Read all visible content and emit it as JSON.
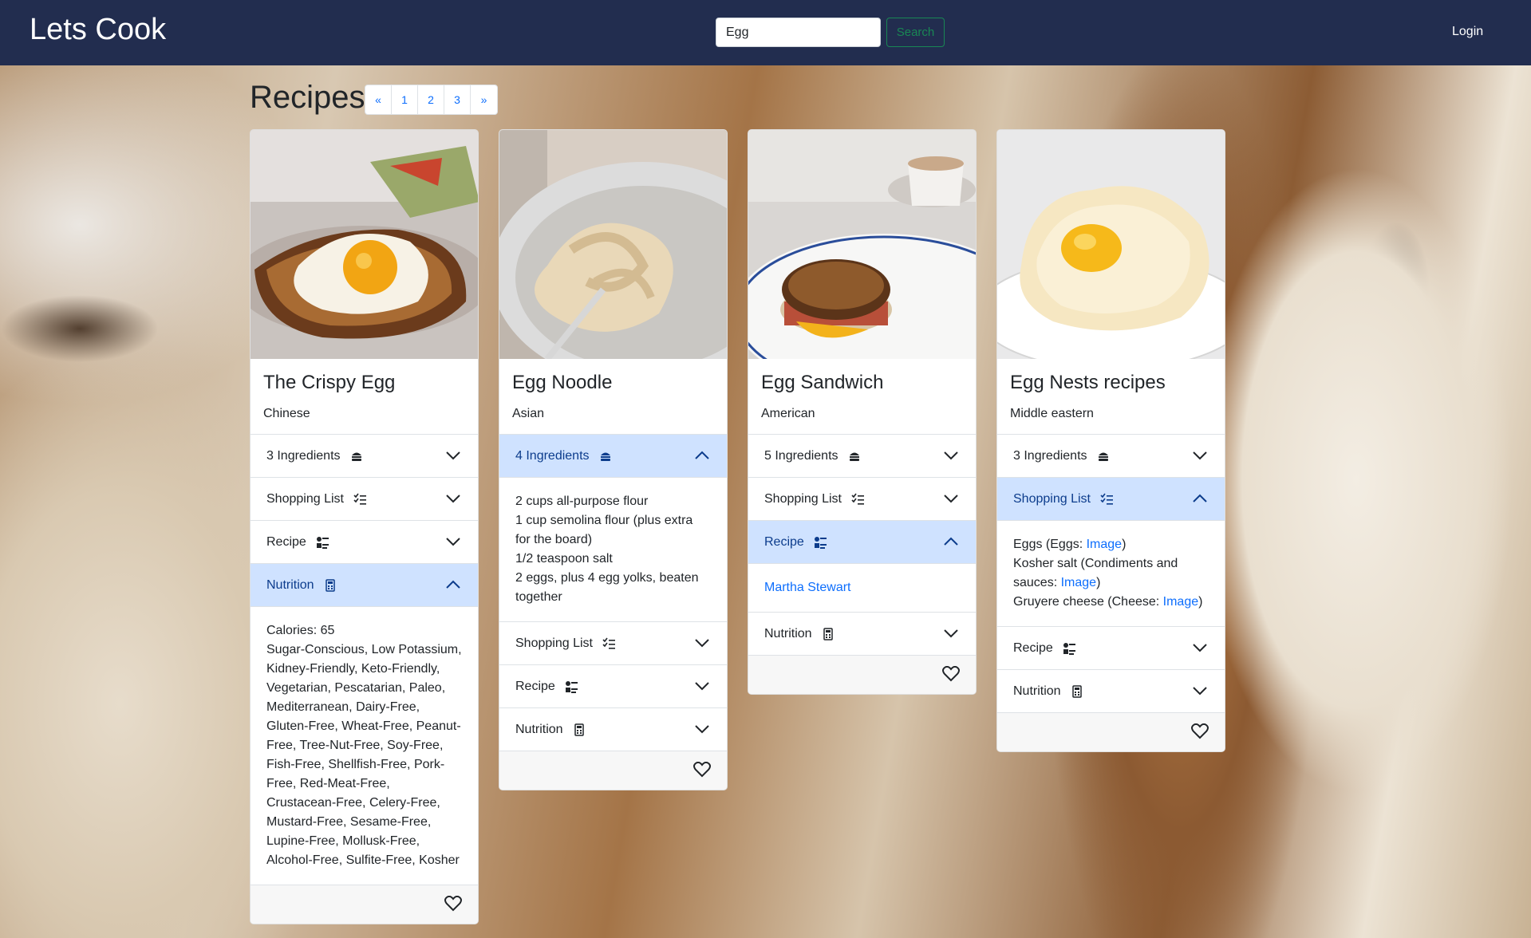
{
  "header": {
    "brand": "Lets Cook",
    "search_value": "Egg",
    "search_button": "Search",
    "login": "Login"
  },
  "page": {
    "title": "Recipes",
    "pagination": [
      "«",
      "1",
      "2",
      "3",
      "»"
    ]
  },
  "cards": [
    {
      "title": "The Crispy Egg",
      "cuisine": "Chinese",
      "ingredients_label": "3 Ingredients",
      "shopping_label": "Shopping List",
      "recipe_label": "Recipe",
      "nutrition_label": "Nutrition",
      "open_section": "nutrition",
      "nutrition_calories": "Calories: 65",
      "nutrition_labels": "Sugar-Conscious, Low Potassium, Kidney-Friendly, Keto-Friendly, Vegetarian, Pescatarian, Paleo, Mediterranean, Dairy-Free, Gluten-Free, Wheat-Free, Peanut-Free, Tree-Nut-Free, Soy-Free, Fish-Free, Shellfish-Free, Pork-Free, Red-Meat-Free, Crustacean-Free, Celery-Free, Mustard-Free, Sesame-Free, Lupine-Free, Mollusk-Free, Alcohol-Free, Sulfite-Free, Kosher"
    },
    {
      "title": "Egg Noodle",
      "cuisine": "Asian",
      "ingredients_label": "4 Ingredients",
      "shopping_label": "Shopping List",
      "recipe_label": "Recipe",
      "nutrition_label": "Nutrition",
      "open_section": "ingredients",
      "ingredients": [
        "2 cups all-purpose flour",
        "1 cup semolina flour (plus extra for the board)",
        "1/2 teaspoon salt",
        "2 eggs, plus 4 egg yolks, beaten together"
      ]
    },
    {
      "title": "Egg Sandwich",
      "cuisine": "American",
      "ingredients_label": "5 Ingredients",
      "shopping_label": "Shopping List",
      "recipe_label": "Recipe",
      "nutrition_label": "Nutrition",
      "open_section": "recipe",
      "recipe_source": "Martha Stewart"
    },
    {
      "title": "Egg Nests recipes",
      "cuisine": "Middle eastern",
      "ingredients_label": "3 Ingredients",
      "shopping_label": "Shopping List",
      "recipe_label": "Recipe",
      "nutrition_label": "Nutrition",
      "open_section": "shopping",
      "shopping": [
        {
          "item": "Eggs (Eggs: ",
          "link": "Image",
          "after": ")"
        },
        {
          "item": "Kosher salt (Condiments and sauces: ",
          "link": "Image",
          "after": ")"
        },
        {
          "item": "Gruyere cheese (Cheese: ",
          "link": "Image",
          "after": ")"
        }
      ]
    }
  ],
  "icons": {
    "ingredients": "burger-icon",
    "shopping": "checklist-icon",
    "recipe": "recipe-icon",
    "nutrition": "calculator-icon",
    "favorite": "heart-icon"
  },
  "colors": {
    "navbar": "#222d4f",
    "accordion_open": "#cfe2ff",
    "link": "#0d6efd",
    "search_button": "#198754"
  }
}
